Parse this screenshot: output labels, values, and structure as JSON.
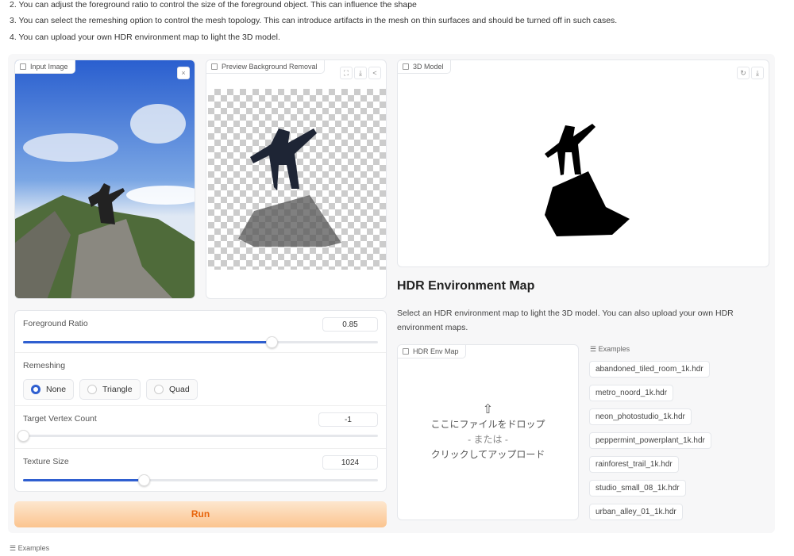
{
  "instructions": [
    "2. You can adjust the foreground ratio to control the size of the foreground object. This can influence the shape",
    "3. You can select the remeshing option to control the mesh topology. This can introduce artifacts in the mesh on thin surfaces and should be turned off in such cases.",
    "4. You can upload your own HDR environment map to light the 3D model."
  ],
  "input_image": {
    "label": "Input Image",
    "close": "×"
  },
  "preview": {
    "label": "Preview Background Removal"
  },
  "model": {
    "label": "3D Model"
  },
  "controls": {
    "foreground_ratio": {
      "label": "Foreground Ratio",
      "value": "0.85",
      "fraction": 0.7
    },
    "remeshing": {
      "label": "Remeshing",
      "options": [
        "None",
        "Triangle",
        "Quad"
      ],
      "selected": "None"
    },
    "vertex_count": {
      "label": "Target Vertex Count",
      "value": "-1",
      "fraction": 0
    },
    "texture_size": {
      "label": "Texture Size",
      "value": "1024",
      "fraction": 0.34
    }
  },
  "run_label": "Run",
  "hdr": {
    "title": "HDR Environment Map",
    "desc": "Select an HDR environment map to light the 3D model. You can also upload your own HDR environment maps.",
    "upload_label": "HDR Env Map",
    "drop": "ここにファイルをドロップ",
    "or": "- または -",
    "click": "クリックしてアップロード",
    "examples_label": "Examples",
    "examples": [
      "abandoned_tiled_room_1k.hdr",
      "metro_noord_1k.hdr",
      "neon_photostudio_1k.hdr",
      "peppermint_powerplant_1k.hdr",
      "rainforest_trail_1k.hdr",
      "studio_small_08_1k.hdr",
      "urban_alley_01_1k.hdr"
    ]
  },
  "examples_label": "Examples",
  "colors": {
    "accent": "#2f5fd0",
    "run": "#e8650c"
  }
}
